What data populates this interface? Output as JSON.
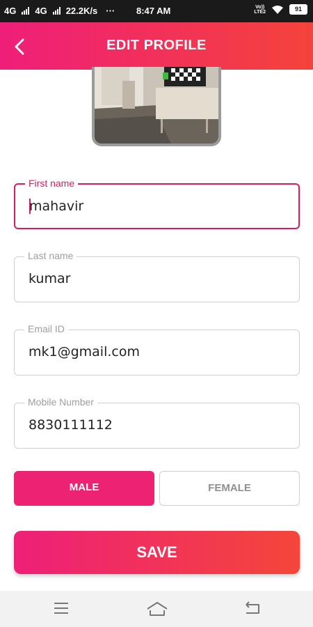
{
  "status_bar": {
    "net1": "4G",
    "net2": "4G",
    "speed": "22.2K/s",
    "dots": "···",
    "time": "8:47 AM",
    "volte_top": "Vo))",
    "volte_bottom": "LTE2",
    "battery": "91"
  },
  "header": {
    "title": "EDIT PROFILE"
  },
  "form": {
    "first_name": {
      "label": "First name",
      "value": "mahavir"
    },
    "last_name": {
      "label": "Last name",
      "value": "kumar"
    },
    "email": {
      "label": "Email ID",
      "value": "mk1@gmail.com"
    },
    "mobile": {
      "label": "Mobile Number",
      "value": "8830111112"
    }
  },
  "gender": {
    "male_label": "MALE",
    "female_label": "FEMALE",
    "selected": "MALE"
  },
  "save_label": "SAVE",
  "colors": {
    "accent_start": "#ef1e7a",
    "accent_end": "#f4433a",
    "active_border": "#d81b60"
  },
  "icons": {
    "back": "back-arrow-icon",
    "menu": "menu-icon",
    "home": "home-icon",
    "return": "return-icon"
  }
}
